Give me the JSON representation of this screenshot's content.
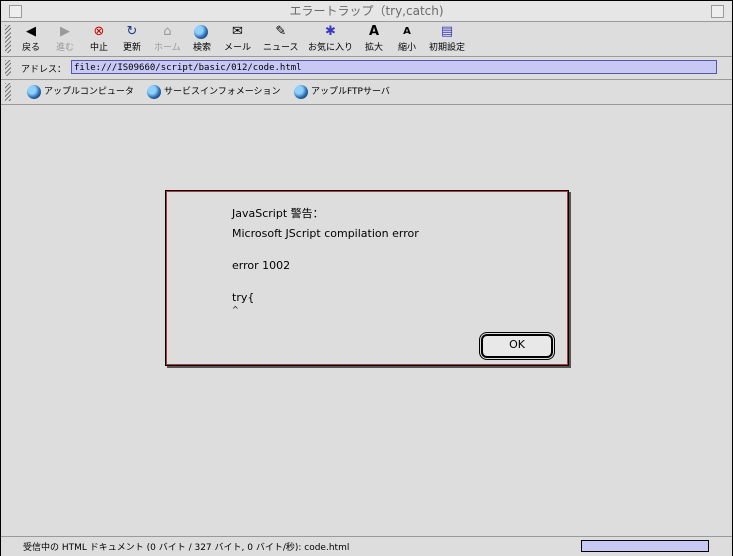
{
  "window": {
    "title": "エラートラップ（try,catch)"
  },
  "toolbar": {
    "buttons": [
      {
        "label": "戻る",
        "icon": "back-arrow"
      },
      {
        "label": "進む",
        "icon": "forward-arrow"
      },
      {
        "label": "中止",
        "icon": "stop"
      },
      {
        "label": "更新",
        "icon": "refresh"
      },
      {
        "label": "ホーム",
        "icon": "home"
      },
      {
        "label": "検索",
        "icon": "search-globe"
      },
      {
        "label": "メール",
        "icon": "mail"
      },
      {
        "label": "ニュース",
        "icon": "news"
      },
      {
        "label": "お気に入り",
        "icon": "favorites"
      },
      {
        "label": "拡大",
        "icon": "text-larger"
      },
      {
        "label": "縮小",
        "icon": "text-smaller"
      },
      {
        "label": "初期設定",
        "icon": "preferences"
      }
    ]
  },
  "address": {
    "label": "アドレス：",
    "value": "file:///IS09660/script/basic/012/code.html"
  },
  "favorites": [
    {
      "label": "アップルコンピュータ"
    },
    {
      "label": "サービスインフォメーション"
    },
    {
      "label": "アップルFTPサーバ"
    }
  ],
  "dialog": {
    "title": "JavaScript 警告：",
    "line1": "Microsoft JScript compilation error",
    "line2": "error 1002",
    "line3": "try{",
    "caret": "^",
    "ok_label": "OK"
  },
  "status": {
    "text": "受信中の HTML ドキュメント (0 バイト / 327 バイト, 0 バイト/秒): code.html",
    "progress": 0
  },
  "colors": {
    "address_bg": "#c8c8f4",
    "dialog_border": "#b23a3a",
    "stop_red": "#cc0000"
  }
}
